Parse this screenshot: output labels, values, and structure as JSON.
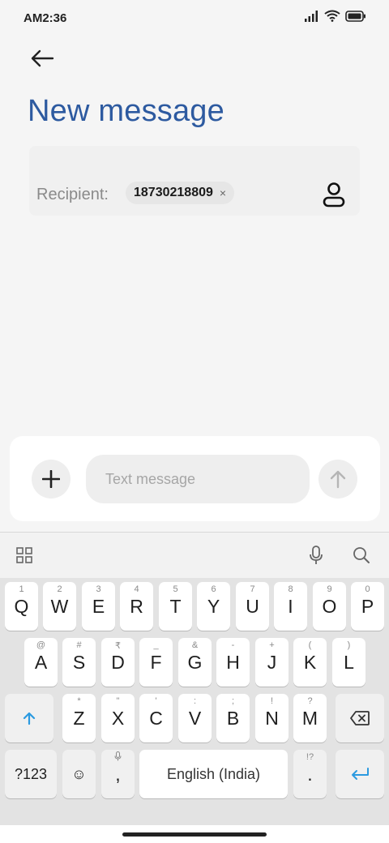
{
  "status_bar": {
    "time": "AM2:36"
  },
  "header": {
    "title": "New message"
  },
  "recipient": {
    "label": "Recipient:",
    "chip": "18730218809",
    "chip_close": "×"
  },
  "compose": {
    "placeholder": "Text message"
  },
  "keyboard": {
    "row1": [
      {
        "main": "Q",
        "hint": "1"
      },
      {
        "main": "W",
        "hint": "2"
      },
      {
        "main": "E",
        "hint": "3"
      },
      {
        "main": "R",
        "hint": "4"
      },
      {
        "main": "T",
        "hint": "5"
      },
      {
        "main": "Y",
        "hint": "6"
      },
      {
        "main": "U",
        "hint": "7"
      },
      {
        "main": "I",
        "hint": "8"
      },
      {
        "main": "O",
        "hint": "9"
      },
      {
        "main": "P",
        "hint": "0"
      }
    ],
    "row2": [
      {
        "main": "A",
        "hint": "@"
      },
      {
        "main": "S",
        "hint": "#"
      },
      {
        "main": "D",
        "hint": "₹"
      },
      {
        "main": "F",
        "hint": "_"
      },
      {
        "main": "G",
        "hint": "&"
      },
      {
        "main": "H",
        "hint": "-"
      },
      {
        "main": "J",
        "hint": "+"
      },
      {
        "main": "K",
        "hint": "("
      },
      {
        "main": "L",
        "hint": ")"
      }
    ],
    "row3": [
      {
        "main": "Z",
        "hint": "*"
      },
      {
        "main": "X",
        "hint": "\""
      },
      {
        "main": "C",
        "hint": "'"
      },
      {
        "main": "V",
        "hint": ":"
      },
      {
        "main": "B",
        "hint": ";"
      },
      {
        "main": "N",
        "hint": "!"
      },
      {
        "main": "M",
        "hint": "?"
      }
    ],
    "num_key": "?123",
    "emoji_key": "☺",
    "comma_key": ",",
    "space_label": "English (India)",
    "period_key": ".",
    "period_hint": "!?"
  },
  "colors": {
    "title": "#2d5aa0",
    "accent": "#2b9ae0"
  }
}
